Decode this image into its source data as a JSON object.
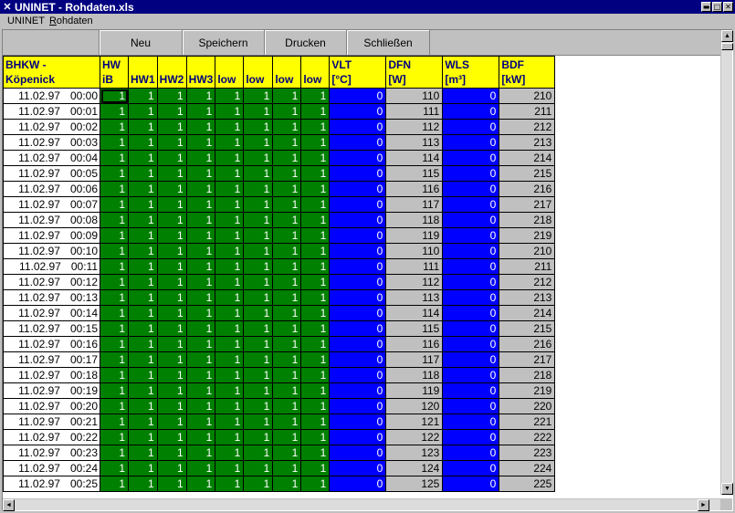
{
  "window": {
    "title": "UNINET - Rohdaten.xls",
    "title_icon": "✕",
    "controls": {
      "minimize": "▬",
      "maximize": "□",
      "close": "✕"
    }
  },
  "menu": {
    "items": [
      {
        "label": "UNINET"
      },
      {
        "label_prefix": "",
        "label_underlined": "R",
        "label_rest": "ohdaten"
      }
    ]
  },
  "toolbar": {
    "buttons": [
      {
        "name": "neu",
        "label": "Neu"
      },
      {
        "name": "speichern",
        "label": "Speichern"
      },
      {
        "name": "drucken",
        "label": "Drucken"
      },
      {
        "name": "schliessen",
        "label": "Schließen"
      }
    ]
  },
  "table": {
    "headers": [
      {
        "line1": "BHKW -",
        "line2": "Köpenick"
      },
      {
        "line1": "HW",
        "line2": "iB"
      },
      {
        "line1": "",
        "line2": "HW1"
      },
      {
        "line1": "",
        "line2": "HW2"
      },
      {
        "line1": "",
        "line2": "HW3"
      },
      {
        "line1": "",
        "line2": "low"
      },
      {
        "line1": "",
        "line2": "low"
      },
      {
        "line1": "",
        "line2": "low"
      },
      {
        "line1": "",
        "line2": "low"
      },
      {
        "line1": "VLT",
        "line2": "[°C]"
      },
      {
        "line1": "DFN",
        "line2": "[W]"
      },
      {
        "line1": "WLS",
        "line2": "[m³]"
      },
      {
        "line1": "BDF",
        "line2": "[kW]"
      }
    ],
    "rows": [
      {
        "date": "11.02.97",
        "time": "00:00",
        "flags": [
          "1",
          "1",
          "1",
          "1",
          "1",
          "1",
          "1",
          "1"
        ],
        "vlt": "0",
        "dfn": "110",
        "wls": "0",
        "bdf": "210"
      },
      {
        "date": "11.02.97",
        "time": "00:01",
        "flags": [
          "1",
          "1",
          "1",
          "1",
          "1",
          "1",
          "1",
          "1"
        ],
        "vlt": "0",
        "dfn": "111",
        "wls": "0",
        "bdf": "211"
      },
      {
        "date": "11.02.97",
        "time": "00:02",
        "flags": [
          "1",
          "1",
          "1",
          "1",
          "1",
          "1",
          "1",
          "1"
        ],
        "vlt": "0",
        "dfn": "112",
        "wls": "0",
        "bdf": "212"
      },
      {
        "date": "11.02.97",
        "time": "00:03",
        "flags": [
          "1",
          "1",
          "1",
          "1",
          "1",
          "1",
          "1",
          "1"
        ],
        "vlt": "0",
        "dfn": "113",
        "wls": "0",
        "bdf": "213"
      },
      {
        "date": "11.02.97",
        "time": "00:04",
        "flags": [
          "1",
          "1",
          "1",
          "1",
          "1",
          "1",
          "1",
          "1"
        ],
        "vlt": "0",
        "dfn": "114",
        "wls": "0",
        "bdf": "214"
      },
      {
        "date": "11.02.97",
        "time": "00:05",
        "flags": [
          "1",
          "1",
          "1",
          "1",
          "1",
          "1",
          "1",
          "1"
        ],
        "vlt": "0",
        "dfn": "115",
        "wls": "0",
        "bdf": "215"
      },
      {
        "date": "11.02.97",
        "time": "00:06",
        "flags": [
          "1",
          "1",
          "1",
          "1",
          "1",
          "1",
          "1",
          "1"
        ],
        "vlt": "0",
        "dfn": "116",
        "wls": "0",
        "bdf": "216"
      },
      {
        "date": "11.02.97",
        "time": "00:07",
        "flags": [
          "1",
          "1",
          "1",
          "1",
          "1",
          "1",
          "1",
          "1"
        ],
        "vlt": "0",
        "dfn": "117",
        "wls": "0",
        "bdf": "217"
      },
      {
        "date": "11.02.97",
        "time": "00:08",
        "flags": [
          "1",
          "1",
          "1",
          "1",
          "1",
          "1",
          "1",
          "1"
        ],
        "vlt": "0",
        "dfn": "118",
        "wls": "0",
        "bdf": "218"
      },
      {
        "date": "11.02.97",
        "time": "00:09",
        "flags": [
          "1",
          "1",
          "1",
          "1",
          "1",
          "1",
          "1",
          "1"
        ],
        "vlt": "0",
        "dfn": "119",
        "wls": "0",
        "bdf": "219"
      },
      {
        "date": "11.02.97",
        "time": "00:10",
        "flags": [
          "1",
          "1",
          "1",
          "1",
          "1",
          "1",
          "1",
          "1"
        ],
        "vlt": "0",
        "dfn": "110",
        "wls": "0",
        "bdf": "210"
      },
      {
        "date": "11.02.97",
        "time": "00:11",
        "flags": [
          "1",
          "1",
          "1",
          "1",
          "1",
          "1",
          "1",
          "1"
        ],
        "vlt": "0",
        "dfn": "111",
        "wls": "0",
        "bdf": "211"
      },
      {
        "date": "11.02.97",
        "time": "00:12",
        "flags": [
          "1",
          "1",
          "1",
          "1",
          "1",
          "1",
          "1",
          "1"
        ],
        "vlt": "0",
        "dfn": "112",
        "wls": "0",
        "bdf": "212"
      },
      {
        "date": "11.02.97",
        "time": "00:13",
        "flags": [
          "1",
          "1",
          "1",
          "1",
          "1",
          "1",
          "1",
          "1"
        ],
        "vlt": "0",
        "dfn": "113",
        "wls": "0",
        "bdf": "213"
      },
      {
        "date": "11.02.97",
        "time": "00:14",
        "flags": [
          "1",
          "1",
          "1",
          "1",
          "1",
          "1",
          "1",
          "1"
        ],
        "vlt": "0",
        "dfn": "114",
        "wls": "0",
        "bdf": "214"
      },
      {
        "date": "11.02.97",
        "time": "00:15",
        "flags": [
          "1",
          "1",
          "1",
          "1",
          "1",
          "1",
          "1",
          "1"
        ],
        "vlt": "0",
        "dfn": "115",
        "wls": "0",
        "bdf": "215"
      },
      {
        "date": "11.02.97",
        "time": "00:16",
        "flags": [
          "1",
          "1",
          "1",
          "1",
          "1",
          "1",
          "1",
          "1"
        ],
        "vlt": "0",
        "dfn": "116",
        "wls": "0",
        "bdf": "216"
      },
      {
        "date": "11.02.97",
        "time": "00:17",
        "flags": [
          "1",
          "1",
          "1",
          "1",
          "1",
          "1",
          "1",
          "1"
        ],
        "vlt": "0",
        "dfn": "117",
        "wls": "0",
        "bdf": "217"
      },
      {
        "date": "11.02.97",
        "time": "00:18",
        "flags": [
          "1",
          "1",
          "1",
          "1",
          "1",
          "1",
          "1",
          "1"
        ],
        "vlt": "0",
        "dfn": "118",
        "wls": "0",
        "bdf": "218"
      },
      {
        "date": "11.02.97",
        "time": "00:19",
        "flags": [
          "1",
          "1",
          "1",
          "1",
          "1",
          "1",
          "1",
          "1"
        ],
        "vlt": "0",
        "dfn": "119",
        "wls": "0",
        "bdf": "219"
      },
      {
        "date": "11.02.97",
        "time": "00:20",
        "flags": [
          "1",
          "1",
          "1",
          "1",
          "1",
          "1",
          "1",
          "1"
        ],
        "vlt": "0",
        "dfn": "120",
        "wls": "0",
        "bdf": "220"
      },
      {
        "date": "11.02.97",
        "time": "00:21",
        "flags": [
          "1",
          "1",
          "1",
          "1",
          "1",
          "1",
          "1",
          "1"
        ],
        "vlt": "0",
        "dfn": "121",
        "wls": "0",
        "bdf": "221"
      },
      {
        "date": "11.02.97",
        "time": "00:22",
        "flags": [
          "1",
          "1",
          "1",
          "1",
          "1",
          "1",
          "1",
          "1"
        ],
        "vlt": "0",
        "dfn": "122",
        "wls": "0",
        "bdf": "222"
      },
      {
        "date": "11.02.97",
        "time": "00:23",
        "flags": [
          "1",
          "1",
          "1",
          "1",
          "1",
          "1",
          "1",
          "1"
        ],
        "vlt": "0",
        "dfn": "123",
        "wls": "0",
        "bdf": "223"
      },
      {
        "date": "11.02.97",
        "time": "00:24",
        "flags": [
          "1",
          "1",
          "1",
          "1",
          "1",
          "1",
          "1",
          "1"
        ],
        "vlt": "0",
        "dfn": "124",
        "wls": "0",
        "bdf": "224"
      },
      {
        "date": "11.02.97",
        "time": "00:25",
        "flags": [
          "1",
          "1",
          "1",
          "1",
          "1",
          "1",
          "1",
          "1"
        ],
        "vlt": "0",
        "dfn": "125",
        "wls": "0",
        "bdf": "225"
      }
    ]
  },
  "colors": {
    "header_bg": "#ffff00",
    "header_text": "#000080",
    "flag_bg": "#008000",
    "blue_bg": "#0000ff",
    "gray_bg": "#c0c0c0",
    "titlebar": "#000080"
  },
  "scroll": {
    "up_icon": "▲",
    "down_icon": "▼",
    "left_icon": "◄",
    "right_icon": "►"
  }
}
